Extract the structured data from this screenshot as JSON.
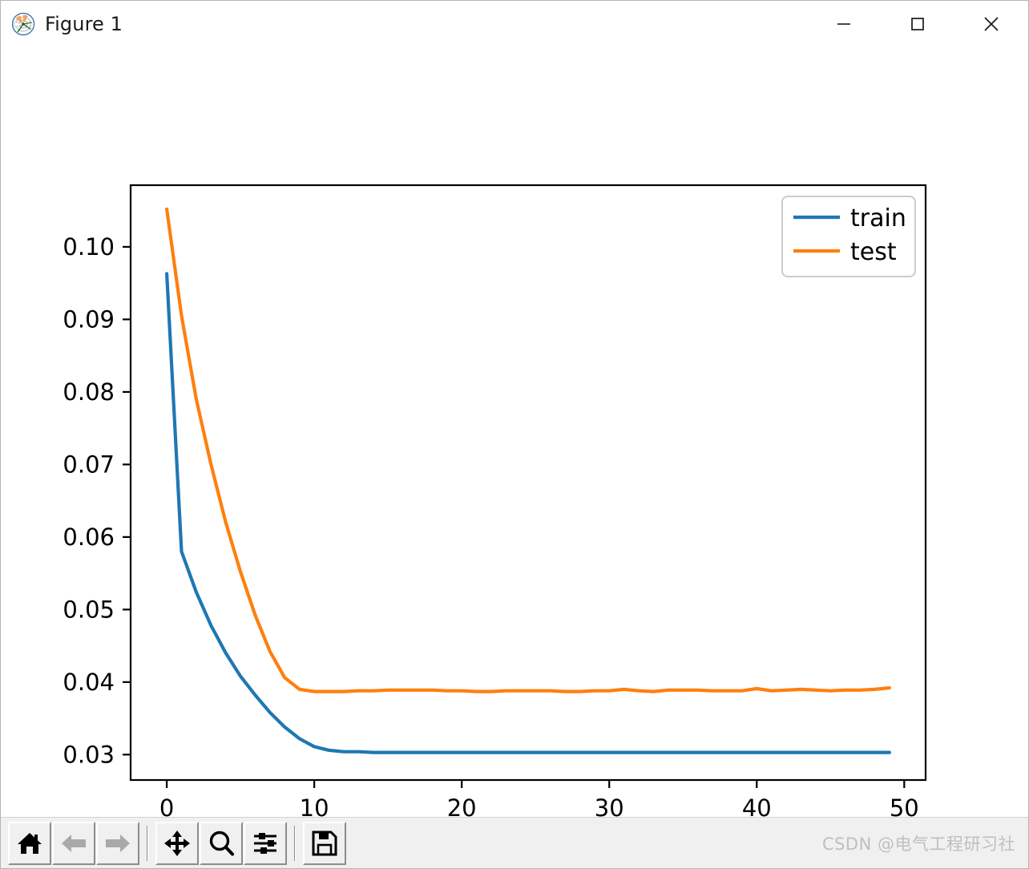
{
  "window": {
    "title": "Figure 1",
    "icon": "matplotlib-icon",
    "controls": {
      "minimize": "minimize-icon",
      "maximize": "maximize-icon",
      "close": "close-icon"
    }
  },
  "toolbar": {
    "buttons": [
      {
        "name": "home",
        "icon": "home-icon",
        "tooltip": "Reset original view",
        "enabled": true
      },
      {
        "name": "back",
        "icon": "left-arrow-icon",
        "tooltip": "Back to previous view",
        "enabled": false
      },
      {
        "name": "forward",
        "icon": "right-arrow-icon",
        "tooltip": "Forward to next view",
        "enabled": false
      },
      {
        "name": "pan",
        "icon": "move-arrows-icon",
        "tooltip": "Pan axes with left mouse, zoom with right",
        "enabled": true
      },
      {
        "name": "zoom",
        "icon": "magnifier-icon",
        "tooltip": "Zoom to rectangle",
        "enabled": true
      },
      {
        "name": "subplots",
        "icon": "sliders-icon",
        "tooltip": "Configure subplots",
        "enabled": true
      },
      {
        "name": "save",
        "icon": "floppy-disk-icon",
        "tooltip": "Save the figure",
        "enabled": true
      }
    ],
    "watermark": "CSDN @电气工程研习社"
  },
  "chart_data": {
    "type": "line",
    "title": "",
    "xlabel": "",
    "ylabel": "",
    "xlim": [
      -2.45,
      51.45
    ],
    "ylim": [
      0.0265,
      0.1085
    ],
    "xticks": [
      0,
      10,
      20,
      30,
      40,
      50
    ],
    "xtick_labels": [
      "0",
      "10",
      "20",
      "30",
      "40",
      "50"
    ],
    "yticks": [
      0.03,
      0.04,
      0.05,
      0.06,
      0.07,
      0.08,
      0.09,
      0.1
    ],
    "ytick_labels": [
      "0.03",
      "0.04",
      "0.05",
      "0.06",
      "0.07",
      "0.08",
      "0.09",
      "0.10"
    ],
    "grid": false,
    "legend_position": "upper right",
    "colors": {
      "train": "#1f77b4",
      "test": "#ff7f0e",
      "axes_edge": "#000000",
      "figure_background": "#ffffff",
      "legend_edge": "#cccccc"
    },
    "x": [
      0,
      1,
      2,
      3,
      4,
      5,
      6,
      7,
      8,
      9,
      10,
      11,
      12,
      13,
      14,
      15,
      16,
      17,
      18,
      19,
      20,
      21,
      22,
      23,
      24,
      25,
      26,
      27,
      28,
      29,
      30,
      31,
      32,
      33,
      34,
      35,
      36,
      37,
      38,
      39,
      40,
      41,
      42,
      43,
      44,
      45,
      46,
      47,
      48,
      49
    ],
    "series": [
      {
        "name": "train",
        "label": "train",
        "color": "#1f77b4",
        "values": [
          0.0963,
          0.058,
          0.0524,
          0.0478,
          0.044,
          0.0408,
          0.0382,
          0.0358,
          0.0338,
          0.0322,
          0.0311,
          0.0306,
          0.0304,
          0.0304,
          0.0303,
          0.0303,
          0.0303,
          0.0303,
          0.0303,
          0.0303,
          0.0303,
          0.0303,
          0.0303,
          0.0303,
          0.0303,
          0.0303,
          0.0303,
          0.0303,
          0.0303,
          0.0303,
          0.0303,
          0.0303,
          0.0303,
          0.0303,
          0.0303,
          0.0303,
          0.0303,
          0.0303,
          0.0303,
          0.0303,
          0.0303,
          0.0303,
          0.0303,
          0.0303,
          0.0303,
          0.0303,
          0.0303,
          0.0303,
          0.0303,
          0.0303
        ]
      },
      {
        "name": "test",
        "label": "test",
        "color": "#ff7f0e",
        "values": [
          0.1052,
          0.0905,
          0.079,
          0.07,
          0.062,
          0.0552,
          0.0492,
          0.0442,
          0.0406,
          0.039,
          0.0387,
          0.0387,
          0.0387,
          0.0388,
          0.0388,
          0.0389,
          0.0389,
          0.0389,
          0.0389,
          0.0388,
          0.0388,
          0.0387,
          0.0387,
          0.0388,
          0.0388,
          0.0388,
          0.0388,
          0.0387,
          0.0387,
          0.0388,
          0.0388,
          0.039,
          0.0388,
          0.0387,
          0.0389,
          0.0389,
          0.0389,
          0.0388,
          0.0388,
          0.0388,
          0.0391,
          0.0388,
          0.0389,
          0.039,
          0.0389,
          0.0388,
          0.0389,
          0.0389,
          0.039,
          0.0392
        ]
      }
    ],
    "legend_entries": [
      "train",
      "test"
    ]
  }
}
